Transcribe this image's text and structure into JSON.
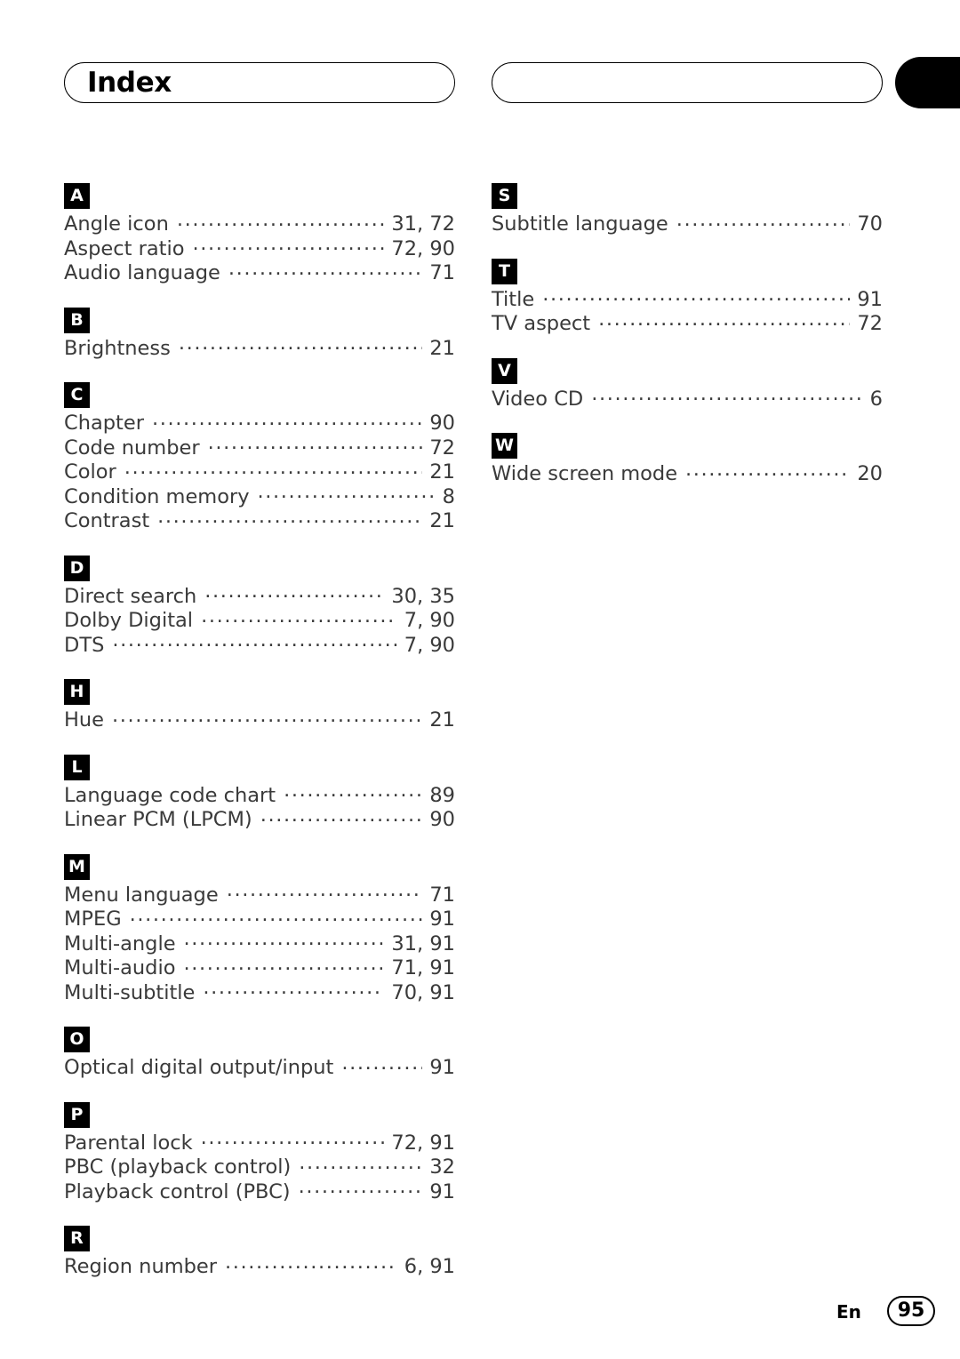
{
  "header": {
    "title": "Index",
    "right_pill_label": ""
  },
  "columns": [
    {
      "side": "left",
      "sections": [
        {
          "letter": "A",
          "entries": [
            {
              "label": "Angle icon",
              "page": "31, 72"
            },
            {
              "label": "Aspect ratio",
              "page": "72, 90"
            },
            {
              "label": "Audio language",
              "page": "71"
            }
          ]
        },
        {
          "letter": "B",
          "entries": [
            {
              "label": "Brightness",
              "page": "21"
            }
          ]
        },
        {
          "letter": "C",
          "entries": [
            {
              "label": "Chapter",
              "page": "90"
            },
            {
              "label": "Code number",
              "page": "72"
            },
            {
              "label": "Color",
              "page": "21"
            },
            {
              "label": "Condition memory",
              "page": "8"
            },
            {
              "label": "Contrast",
              "page": "21"
            }
          ]
        },
        {
          "letter": "D",
          "entries": [
            {
              "label": "Direct search",
              "page": "30, 35"
            },
            {
              "label": "Dolby Digital",
              "page": "7, 90"
            },
            {
              "label": "DTS",
              "page": "7, 90"
            }
          ]
        },
        {
          "letter": "H",
          "entries": [
            {
              "label": "Hue",
              "page": "21"
            }
          ]
        },
        {
          "letter": "L",
          "entries": [
            {
              "label": "Language code chart",
              "page": "89"
            },
            {
              "label": "Linear PCM (LPCM)",
              "page": "90"
            }
          ]
        },
        {
          "letter": "M",
          "entries": [
            {
              "label": "Menu language",
              "page": "71"
            },
            {
              "label": "MPEG",
              "page": "91"
            },
            {
              "label": "Multi-angle",
              "page": "31, 91"
            },
            {
              "label": "Multi-audio",
              "page": "71, 91"
            },
            {
              "label": "Multi-subtitle",
              "page": "70, 91"
            }
          ]
        },
        {
          "letter": "O",
          "entries": [
            {
              "label": "Optical digital output/input",
              "page": "91"
            }
          ]
        },
        {
          "letter": "P",
          "entries": [
            {
              "label": "Parental lock",
              "page": "72, 91"
            },
            {
              "label": "PBC (playback control)",
              "page": "32"
            },
            {
              "label": "Playback control (PBC)",
              "page": "91"
            }
          ]
        },
        {
          "letter": "R",
          "entries": [
            {
              "label": "Region number",
              "page": "6, 91"
            }
          ]
        }
      ]
    },
    {
      "side": "right",
      "sections": [
        {
          "letter": "S",
          "entries": [
            {
              "label": "Subtitle language",
              "page": "70"
            }
          ]
        },
        {
          "letter": "T",
          "entries": [
            {
              "label": "Title",
              "page": "91"
            },
            {
              "label": "TV aspect",
              "page": "72"
            }
          ]
        },
        {
          "letter": "V",
          "entries": [
            {
              "label": "Video CD",
              "page": "6"
            }
          ]
        },
        {
          "letter": "W",
          "entries": [
            {
              "label": "Wide screen mode",
              "page": "20"
            }
          ]
        }
      ]
    }
  ],
  "footer": {
    "language": "En",
    "page_number": "95"
  },
  "colors": {
    "text": "#3a3a3a",
    "badge_bg": "#000000",
    "badge_text": "#ffffff",
    "rule": "#000000"
  }
}
